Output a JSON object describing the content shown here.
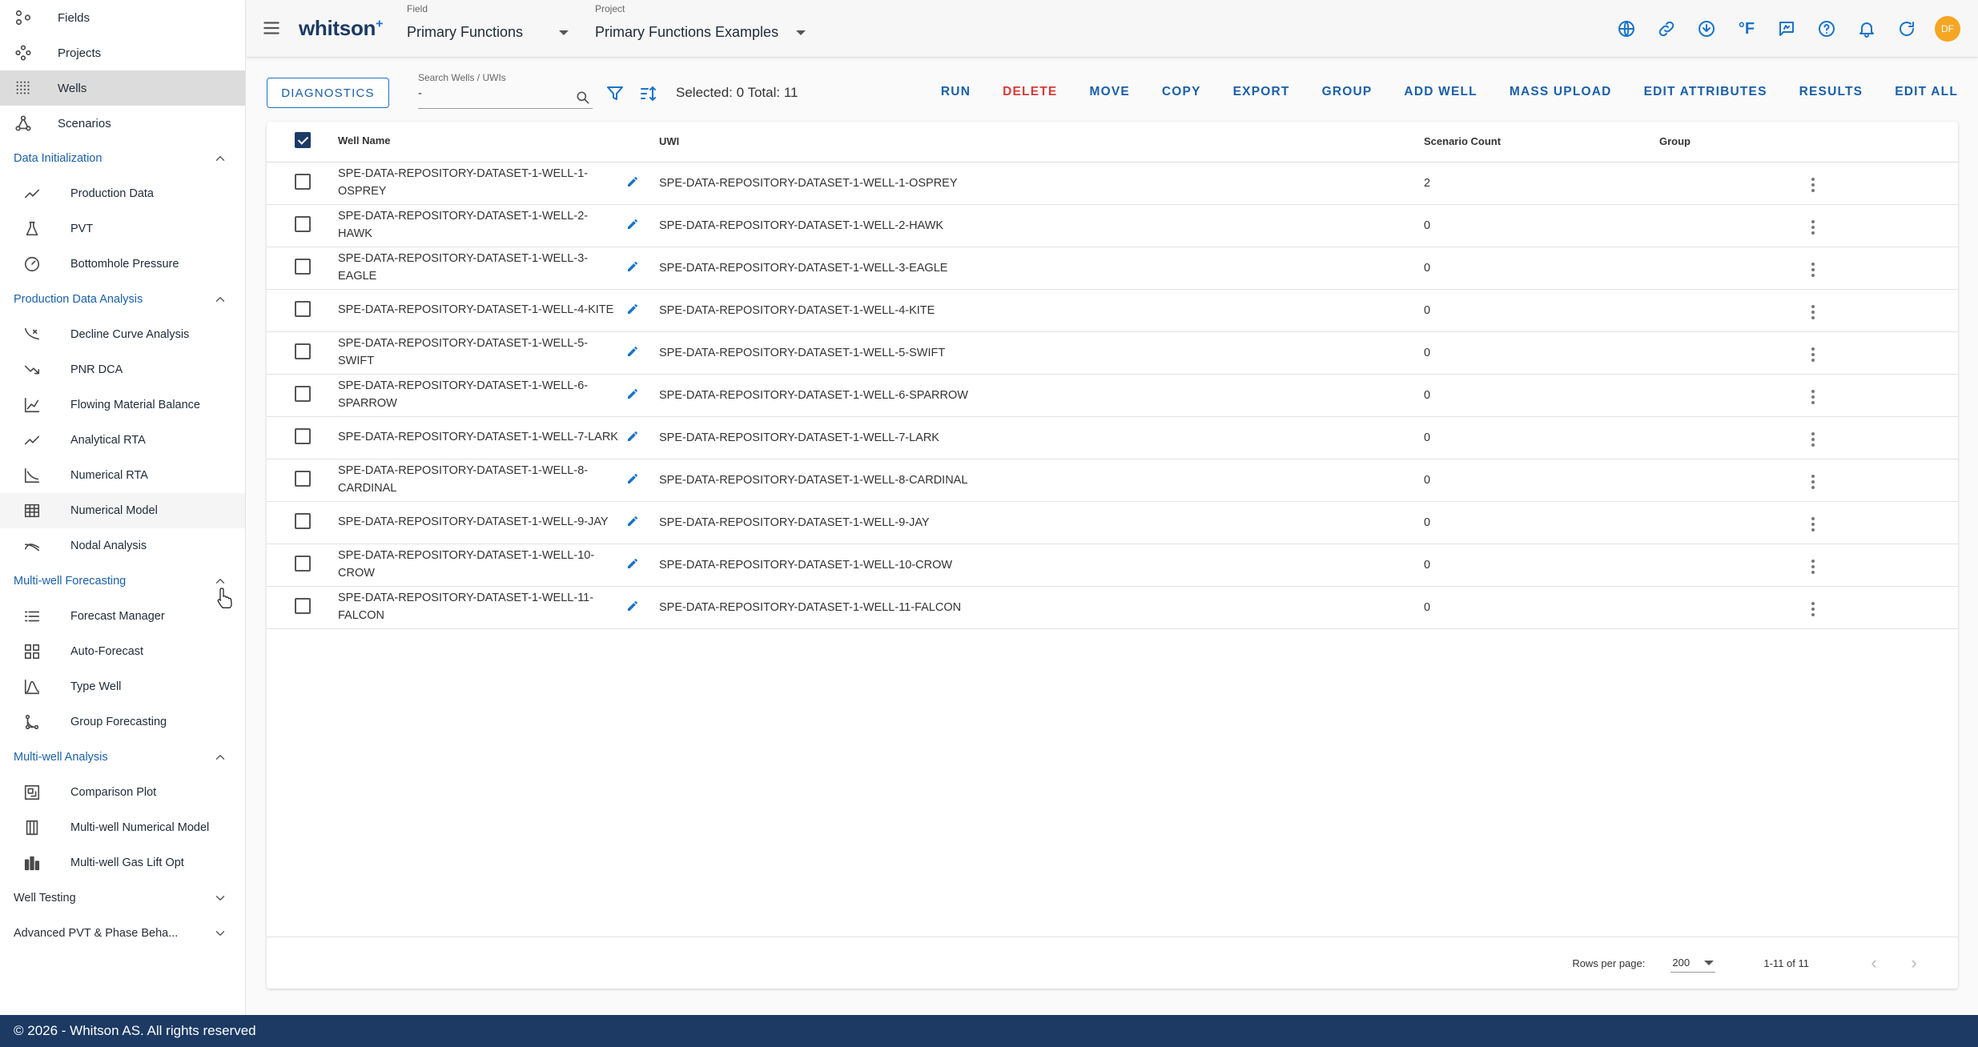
{
  "sidebar": {
    "top_items": [
      {
        "label": "Fields",
        "icon": "fields-icon",
        "active": false
      },
      {
        "label": "Projects",
        "icon": "projects-icon",
        "active": false
      },
      {
        "label": "Wells",
        "icon": "wells-icon",
        "active": true
      },
      {
        "label": "Scenarios",
        "icon": "scenarios-icon",
        "active": false
      }
    ],
    "sections": [
      {
        "title": "Data Initialization",
        "expanded": true,
        "items": [
          {
            "label": "Production Data",
            "icon": "line-chart-icon"
          },
          {
            "label": "PVT",
            "icon": "flask-icon"
          },
          {
            "label": "Bottomhole Pressure",
            "icon": "gauge-icon"
          }
        ]
      },
      {
        "title": "Production Data Analysis",
        "expanded": true,
        "items": [
          {
            "label": "Decline Curve Analysis",
            "icon": "decline-curve-icon"
          },
          {
            "label": "PNR DCA",
            "icon": "trending-down-icon"
          },
          {
            "label": "Flowing Material Balance",
            "icon": "axis-chart-icon"
          },
          {
            "label": "Analytical RTA",
            "icon": "line-chart-icon"
          },
          {
            "label": "Numerical RTA",
            "icon": "axis-decline-icon"
          },
          {
            "label": "Numerical Model",
            "icon": "grid-model-icon"
          },
          {
            "label": "Nodal Analysis",
            "icon": "nodal-icon"
          }
        ]
      },
      {
        "title": "Multi-well Forecasting",
        "expanded": true,
        "items": [
          {
            "label": "Forecast Manager",
            "icon": "list-icon"
          },
          {
            "label": "Auto-Forecast",
            "icon": "dashboard-icon"
          },
          {
            "label": "Type Well",
            "icon": "bell-curve-icon"
          },
          {
            "label": "Group Forecasting",
            "icon": "branch-icon"
          }
        ]
      },
      {
        "title": "Multi-well Analysis",
        "expanded": true,
        "items": [
          {
            "label": "Comparison Plot",
            "icon": "comparison-icon"
          },
          {
            "label": "Multi-well Numerical Model",
            "icon": "columns-icon"
          },
          {
            "label": "Multi-well Gas Lift Opt",
            "icon": "gas-lift-icon"
          }
        ]
      },
      {
        "title": "Well Testing",
        "expanded": false,
        "items": []
      },
      {
        "title": "Advanced PVT & Phase Beha...",
        "expanded": false,
        "items": []
      }
    ]
  },
  "topbar": {
    "logo": "whitson",
    "logo_sup": "+",
    "field_caption": "Field",
    "field_value": "Primary Functions",
    "project_caption": "Project",
    "project_value": "Primary Functions Examples",
    "temp_unit": "°F",
    "avatar_initials": "DF"
  },
  "toolbar": {
    "diagnostics_label": "DIAGNOSTICS",
    "search_label": "Search Wells / UWIs",
    "search_value": "-",
    "selection_text": "Selected: 0 Total: 11",
    "actions": [
      "RUN",
      "DELETE",
      "MOVE",
      "COPY",
      "EXPORT",
      "GROUP",
      "ADD WELL",
      "MASS UPLOAD",
      "EDIT ATTRIBUTES",
      "RESULTS",
      "EDIT ALL"
    ]
  },
  "table": {
    "header_checked": true,
    "columns": [
      "Well Name",
      "UWI",
      "Scenario Count",
      "Group"
    ],
    "rows": [
      {
        "name": "SPE-DATA-REPOSITORY-DATASET-1-WELL-1-OSPREY",
        "uwi": "SPE-DATA-REPOSITORY-DATASET-1-WELL-1-OSPREY",
        "count": "2",
        "group": ""
      },
      {
        "name": "SPE-DATA-REPOSITORY-DATASET-1-WELL-2-HAWK",
        "uwi": "SPE-DATA-REPOSITORY-DATASET-1-WELL-2-HAWK",
        "count": "0",
        "group": ""
      },
      {
        "name": "SPE-DATA-REPOSITORY-DATASET-1-WELL-3-EAGLE",
        "uwi": "SPE-DATA-REPOSITORY-DATASET-1-WELL-3-EAGLE",
        "count": "0",
        "group": ""
      },
      {
        "name": "SPE-DATA-REPOSITORY-DATASET-1-WELL-4-KITE",
        "uwi": "SPE-DATA-REPOSITORY-DATASET-1-WELL-4-KITE",
        "count": "0",
        "group": ""
      },
      {
        "name": "SPE-DATA-REPOSITORY-DATASET-1-WELL-5-SWIFT",
        "uwi": "SPE-DATA-REPOSITORY-DATASET-1-WELL-5-SWIFT",
        "count": "0",
        "group": ""
      },
      {
        "name": "SPE-DATA-REPOSITORY-DATASET-1-WELL-6-SPARROW",
        "uwi": "SPE-DATA-REPOSITORY-DATASET-1-WELL-6-SPARROW",
        "count": "0",
        "group": ""
      },
      {
        "name": "SPE-DATA-REPOSITORY-DATASET-1-WELL-7-LARK",
        "uwi": "SPE-DATA-REPOSITORY-DATASET-1-WELL-7-LARK",
        "count": "0",
        "group": ""
      },
      {
        "name": "SPE-DATA-REPOSITORY-DATASET-1-WELL-8-CARDINAL",
        "uwi": "SPE-DATA-REPOSITORY-DATASET-1-WELL-8-CARDINAL",
        "count": "0",
        "group": ""
      },
      {
        "name": "SPE-DATA-REPOSITORY-DATASET-1-WELL-9-JAY",
        "uwi": "SPE-DATA-REPOSITORY-DATASET-1-WELL-9-JAY",
        "count": "0",
        "group": ""
      },
      {
        "name": "SPE-DATA-REPOSITORY-DATASET-1-WELL-10-CROW",
        "uwi": "SPE-DATA-REPOSITORY-DATASET-1-WELL-10-CROW",
        "count": "0",
        "group": ""
      },
      {
        "name": "SPE-DATA-REPOSITORY-DATASET-1-WELL-11-FALCON",
        "uwi": "SPE-DATA-REPOSITORY-DATASET-1-WELL-11-FALCON",
        "count": "0",
        "group": ""
      }
    ]
  },
  "pagination": {
    "rows_label": "Rows per page:",
    "rows_value": "200",
    "range": "1-11 of 11"
  },
  "footer": {
    "text": "© 2026 - Whitson AS. All rights reserved"
  },
  "colors": {
    "brand_dark": "#1c3a64",
    "accent_blue": "#1a73c9",
    "danger": "#d63a3a",
    "avatar": "#f5a623"
  }
}
